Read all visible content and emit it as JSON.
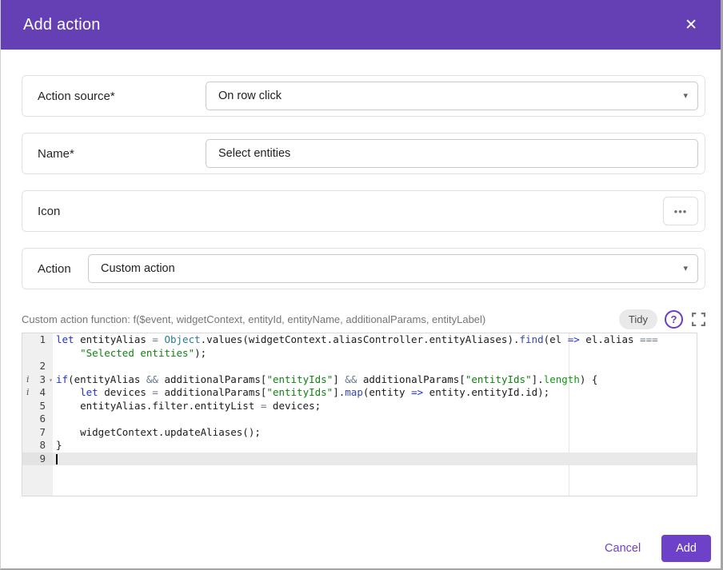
{
  "dialog": {
    "title": "Add action"
  },
  "icons": {
    "close": "✕",
    "dropdown_arrow": "▾",
    "more_dots": "•••",
    "help": "?",
    "fold_arrow": "▾",
    "annotation_info": "i"
  },
  "fields": {
    "action_source": {
      "label": "Action source*",
      "value": "On row click"
    },
    "name": {
      "label": "Name*",
      "value": "Select entities"
    },
    "icon": {
      "label": "Icon"
    },
    "action": {
      "label": "Action",
      "value": "Custom action"
    }
  },
  "function_section": {
    "label": "Custom action function: f($event, widgetContext, entityId, entityName, additionalParams, entityLabel)",
    "tidy_label": "Tidy"
  },
  "code_editor": {
    "rows": [
      {
        "num": "1",
        "segments": [
          [
            "kw",
            "let"
          ],
          [
            "plain",
            " entityAlias "
          ],
          [
            "op",
            "="
          ],
          [
            "plain",
            " "
          ],
          [
            "cls",
            "Object"
          ],
          [
            "plain",
            ".values(widgetContext.aliasController.entityAliases)."
          ],
          [
            "fn",
            "find"
          ],
          [
            "plain",
            "(el "
          ],
          [
            "kw",
            "=>"
          ],
          [
            "plain",
            " el.alias "
          ],
          [
            "op",
            "==="
          ]
        ]
      },
      {
        "num": "",
        "segments": [
          [
            "plain",
            "    "
          ],
          [
            "str",
            "\"Selected entities\""
          ],
          [
            "plain",
            ");"
          ]
        ]
      },
      {
        "num": "2",
        "segments": []
      },
      {
        "num": "3",
        "info": true,
        "fold": true,
        "segments": [
          [
            "kw",
            "if"
          ],
          [
            "plain",
            "(entityAlias "
          ],
          [
            "op",
            "&&"
          ],
          [
            "plain",
            " additionalParams["
          ],
          [
            "str",
            "\"entityIds\""
          ],
          [
            "plain",
            "] "
          ],
          [
            "op",
            "&&"
          ],
          [
            "plain",
            " additionalParams["
          ],
          [
            "str",
            "\"entityIds\""
          ],
          [
            "plain",
            "]."
          ],
          [
            "const",
            "length"
          ],
          [
            "plain",
            ") {"
          ]
        ]
      },
      {
        "num": "4",
        "info": true,
        "segments": [
          [
            "plain",
            "    "
          ],
          [
            "kw",
            "let"
          ],
          [
            "plain",
            " devices "
          ],
          [
            "op",
            "="
          ],
          [
            "plain",
            " additionalParams["
          ],
          [
            "str",
            "\"entityIds\""
          ],
          [
            "plain",
            "]."
          ],
          [
            "fn",
            "map"
          ],
          [
            "plain",
            "(entity "
          ],
          [
            "kw",
            "=>"
          ],
          [
            "plain",
            " entity.entityId.id);"
          ]
        ]
      },
      {
        "num": "5",
        "segments": [
          [
            "plain",
            "    entityAlias.filter.entityList "
          ],
          [
            "op",
            "="
          ],
          [
            "plain",
            " devices;"
          ]
        ]
      },
      {
        "num": "6",
        "segments": []
      },
      {
        "num": "7",
        "segments": [
          [
            "plain",
            "    widgetContext.updateAliases();"
          ]
        ]
      },
      {
        "num": "8",
        "segments": [
          [
            "plain",
            "}"
          ]
        ]
      },
      {
        "num": "9",
        "active": true,
        "cursor": true,
        "segments": []
      }
    ]
  },
  "footer": {
    "cancel_label": "Cancel",
    "add_label": "Add"
  },
  "colors": {
    "header_purple": "#6540b5",
    "accent_purple": "#6d41c8",
    "help_icon_purple": "#6a3bc5",
    "gutter_bg": "#f0f0f0",
    "active_line_bg": "#e9e9e9",
    "token_keyword": "#2431cd",
    "token_operator": "#68768a",
    "token_string": "#108211",
    "token_class": "#2d7b91",
    "token_function": "#3347b0",
    "token_constant": "#0f9812"
  }
}
